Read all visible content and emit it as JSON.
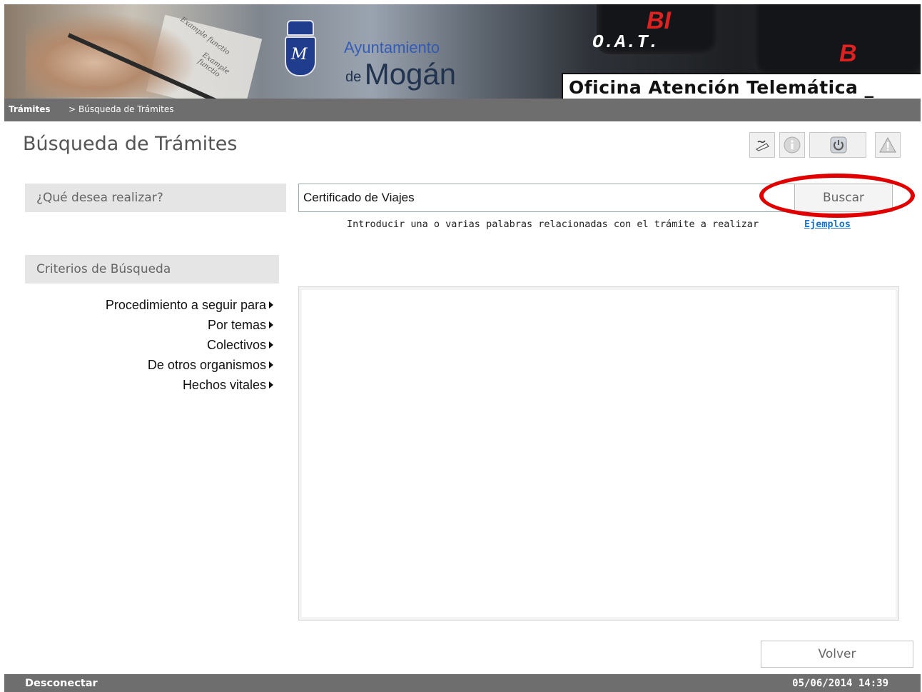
{
  "header": {
    "brand_line1": "Ayuntamiento",
    "brand_de": "de",
    "brand_name": "Mogán",
    "ort_label": "O.A.T.",
    "office_title": "Oficina Atención Telemática _",
    "paper_text_1": "Example functio",
    "paper_text_2": "Example functio"
  },
  "breadcrumb": {
    "root": "Trámites",
    "separator": ">",
    "current": "Búsqueda de Trámites"
  },
  "page_title": "Búsqueda de Trámites",
  "toolbar": {
    "icons": [
      "signature-icon",
      "info-icon",
      "power-icon",
      "warning-icon"
    ]
  },
  "search": {
    "label": "¿Qué desea realizar?",
    "value": "Certificado de Viajes",
    "button_label": "Buscar",
    "hint": "Introducir una o varias palabras relacionadas con el trámite a realizar",
    "examples_link": "Ejemplos"
  },
  "criteria": {
    "title": "Criterios de Búsqueda",
    "items": [
      {
        "label": "Procedimiento a seguir para"
      },
      {
        "label": "Por temas"
      },
      {
        "label": "Colectivos"
      },
      {
        "label": "De otros organismos"
      },
      {
        "label": "Hechos vitales"
      }
    ]
  },
  "actions": {
    "back_label": "Volver"
  },
  "footer": {
    "logout_label": "Desconectar",
    "datetime": "05/06/2014 14:39"
  },
  "colors": {
    "bar_gray": "#6e6e6e",
    "label_bg": "#e5e5e5",
    "highlight_red": "#e00000",
    "link_blue": "#1b74c9"
  }
}
